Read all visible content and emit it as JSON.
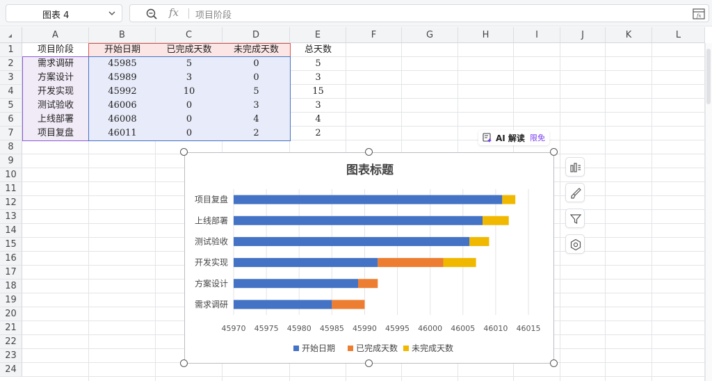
{
  "name_box": {
    "value": "图表 4"
  },
  "formula_bar": {
    "fx_symbol": "fx",
    "value": "项目阶段"
  },
  "columns": [
    "A",
    "B",
    "C",
    "D",
    "E",
    "F",
    "G",
    "H",
    "I",
    "J",
    "K",
    "L"
  ],
  "rows": [
    "1",
    "2",
    "3",
    "4",
    "5",
    "6",
    "7",
    "8",
    "9",
    "10",
    "11",
    "12",
    "13",
    "14",
    "15",
    "16",
    "17",
    "18",
    "19",
    "20",
    "21",
    "22",
    "23",
    "24"
  ],
  "table": {
    "headers": [
      "项目阶段",
      "开始日期",
      "已完成天数",
      "未完成天数",
      "总天数"
    ],
    "rows": [
      [
        "需求调研",
        "45985",
        "5",
        "0",
        "5"
      ],
      [
        "方案设计",
        "45989",
        "3",
        "0",
        "3"
      ],
      [
        "开发实现",
        "45992",
        "10",
        "5",
        "15"
      ],
      [
        "测试验收",
        "46006",
        "0",
        "3",
        "3"
      ],
      [
        "上线部署",
        "46008",
        "0",
        "4",
        "4"
      ],
      [
        "项目复盘",
        "46011",
        "0",
        "2",
        "2"
      ]
    ]
  },
  "ai_badge": {
    "label": "AI 解读",
    "tag": "限免"
  },
  "side_tools": [
    "chart-elements-icon",
    "chart-style-icon",
    "chart-filter-icon",
    "chart-settings-icon"
  ],
  "colors": {
    "series_start": "#4472c4",
    "series_done": "#ed7d31",
    "series_todo": "#f1b800",
    "selection_blue": "#4472c4",
    "selection_red": "#d9534f",
    "selection_purple": "#8b5bd6"
  },
  "chart_data": {
    "type": "bar",
    "orientation": "horizontal",
    "stacked": true,
    "title": "图表标题",
    "categories": [
      "需求调研",
      "方案设计",
      "开发实现",
      "测试验收",
      "上线部署",
      "项目复盘"
    ],
    "series": [
      {
        "name": "开始日期",
        "values": [
          45985,
          45989,
          45992,
          46006,
          46008,
          46011
        ],
        "color": "#4472c4"
      },
      {
        "name": "已完成天数",
        "values": [
          5,
          3,
          10,
          0,
          0,
          0
        ],
        "color": "#ed7d31"
      },
      {
        "name": "未完成天数",
        "values": [
          0,
          0,
          5,
          3,
          4,
          2
        ],
        "color": "#f1b800"
      }
    ],
    "xlim": [
      45970,
      46015
    ],
    "xticks": [
      "45970",
      "45975",
      "45980",
      "45985",
      "45990",
      "45995",
      "46000",
      "46005",
      "46010",
      "46015"
    ],
    "grid": true,
    "legend_position": "bottom"
  }
}
